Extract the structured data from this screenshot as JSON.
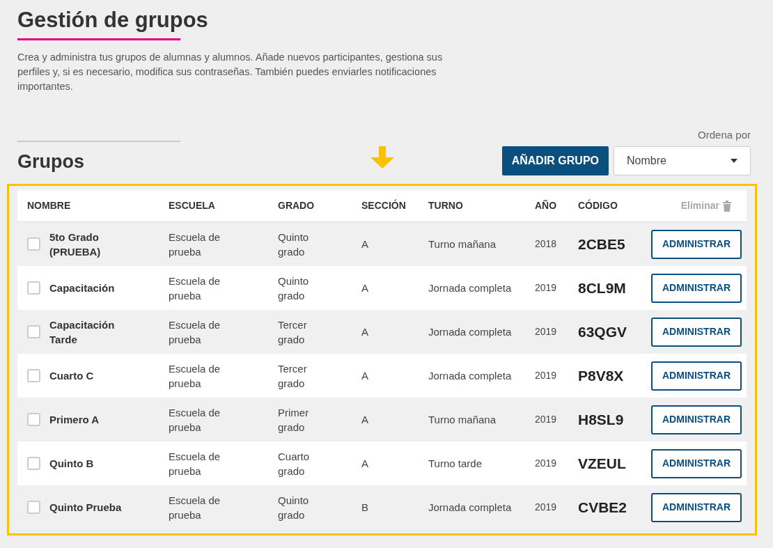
{
  "page": {
    "title": "Gestión de grupos",
    "description": "Crea y administra tus grupos de alumnas y alumnos. Añade nuevos participantes, gestiona sus perfiles y, si es necesario, modifica sus contraseñas. También puedes enviarles notificaciones importantes."
  },
  "section": {
    "title": "Grupos",
    "sort_label": "Ordena por",
    "sort_value": "Nombre",
    "add_button": "AÑADIR GRUPO"
  },
  "table": {
    "columns": [
      "NOMBRE",
      "ESCUELA",
      "GRADO",
      "SECCIÓN",
      "TURNO",
      "AÑO",
      "CÓDIGO"
    ],
    "delete_action": {
      "label": "Eliminar",
      "disabled": true
    },
    "rows": [
      {
        "checked": false,
        "name": "5to Grado (PRUEBA)",
        "school": "Escuela de prueba",
        "grade": "Quinto grado",
        "section": "A",
        "shift": "Turno mañana",
        "year": "2018",
        "code": "2CBE5",
        "action": "ADMINISTRAR"
      },
      {
        "checked": false,
        "name": "Capacitación",
        "school": "Escuela de prueba",
        "grade": "Quinto grado",
        "section": "A",
        "shift": "Jornada completa",
        "year": "2019",
        "code": "8CL9M",
        "action": "ADMINISTRAR"
      },
      {
        "checked": false,
        "name": "Capacitación Tarde",
        "school": "Escuela de prueba",
        "grade": "Tercer grado",
        "section": "A",
        "shift": "Jornada completa",
        "year": "2019",
        "code": "63QGV",
        "action": "ADMINISTRAR"
      },
      {
        "checked": false,
        "name": "Cuarto C",
        "school": "Escuela de prueba",
        "grade": "Tercer grado",
        "section": "A",
        "shift": "Jornada completa",
        "year": "2019",
        "code": "P8V8X",
        "action": "ADMINISTRAR"
      },
      {
        "checked": false,
        "name": "Primero A",
        "school": "Escuela de prueba",
        "grade": "Primer grado",
        "section": "A",
        "shift": "Turno mañana",
        "year": "2019",
        "code": "H8SL9",
        "action": "ADMINISTRAR"
      },
      {
        "checked": false,
        "name": "Quinto B",
        "school": "Escuela de prueba",
        "grade": "Cuarto grado",
        "section": "A",
        "shift": "Turno tarde",
        "year": "2019",
        "code": "VZEUL",
        "action": "ADMINISTRAR"
      },
      {
        "checked": false,
        "name": "Quinto Prueba",
        "school": "Escuela de prueba",
        "grade": "Quinto grado",
        "section": "B",
        "shift": "Jornada completa",
        "year": "2019",
        "code": "CVBE2",
        "action": "ADMINISTRAR"
      }
    ]
  }
}
